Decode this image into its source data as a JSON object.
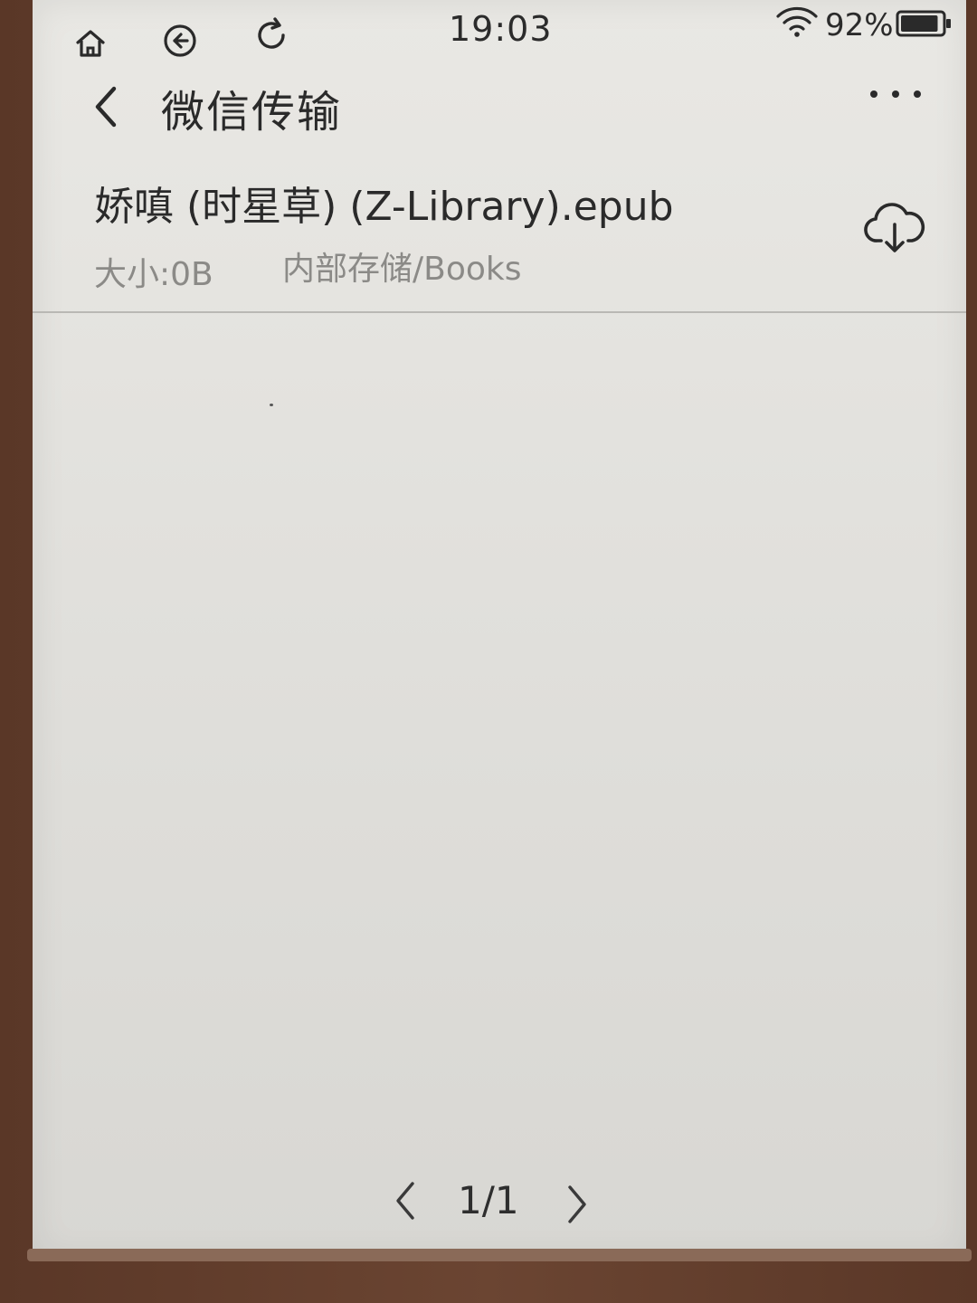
{
  "status_bar": {
    "time": "19:03",
    "battery_percent": "92%",
    "battery_level": 0.92,
    "icons": [
      "home-icon",
      "back-circle-icon",
      "refresh-icon",
      "wifi-icon",
      "battery-icon"
    ]
  },
  "header": {
    "title": "微信传输",
    "back_icon": "chevron-left-icon",
    "more_icon": "more-horizontal-icon"
  },
  "files": [
    {
      "name": "娇嗔 (时星草) (Z-Library).epub",
      "size": "大小:0B",
      "path": "内部存储/Books",
      "action_icon": "cloud-download-icon"
    }
  ],
  "pagination": {
    "text": "1/1",
    "prev_icon": "chevron-left-icon",
    "next_icon": "chevron-right-icon"
  }
}
